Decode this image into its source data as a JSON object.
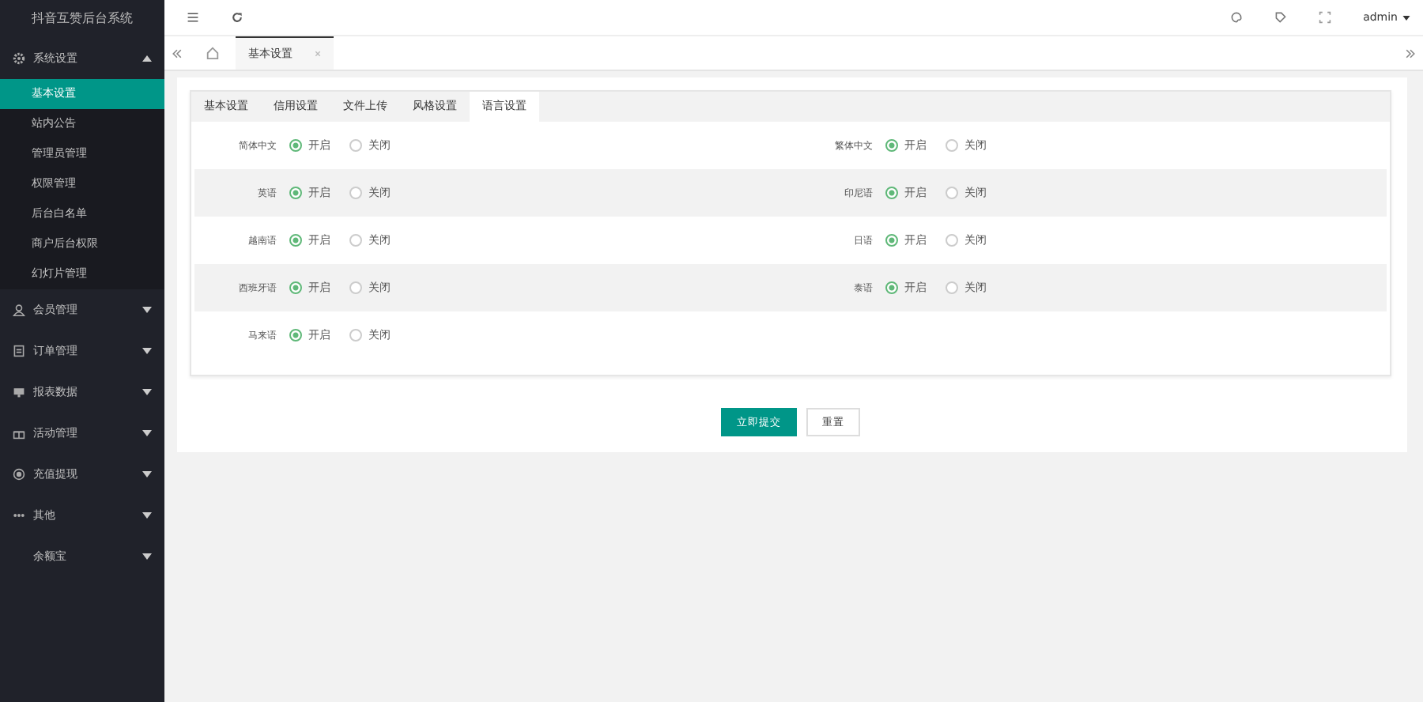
{
  "sidebar": {
    "logo": "抖音互赞后台系统",
    "menus": [
      {
        "label": "系统设置",
        "expanded": true,
        "items": [
          {
            "label": "基本设置",
            "selected": true
          },
          {
            "label": "站内公告",
            "selected": false
          },
          {
            "label": "管理员管理",
            "selected": false
          },
          {
            "label": "权限管理",
            "selected": false
          },
          {
            "label": "后台白名单",
            "selected": false
          },
          {
            "label": "商户后台权限",
            "selected": false
          },
          {
            "label": "幻灯片管理",
            "selected": false
          }
        ]
      },
      {
        "label": "会员管理",
        "expanded": false
      },
      {
        "label": "订单管理",
        "expanded": false
      },
      {
        "label": "报表数据",
        "expanded": false
      },
      {
        "label": "活动管理",
        "expanded": false
      },
      {
        "label": "充值提现",
        "expanded": false
      },
      {
        "label": "其他",
        "expanded": false
      },
      {
        "label": "余额宝",
        "expanded": false
      }
    ]
  },
  "header": {
    "user": "admin"
  },
  "page_tabs": [
    {
      "label": "基本设置",
      "selected": true
    }
  ],
  "form_tabs": [
    {
      "label": "基本设置",
      "selected": false
    },
    {
      "label": "信用设置",
      "selected": false
    },
    {
      "label": "文件上传",
      "selected": false
    },
    {
      "label": "风格设置",
      "selected": false
    },
    {
      "label": "语言设置",
      "selected": true
    }
  ],
  "languages": [
    {
      "name": "简体中文",
      "options": [
        {
          "label": "开启",
          "selected": true
        },
        {
          "label": "关闭",
          "selected": false
        }
      ]
    },
    {
      "name": "繁体中文",
      "options": [
        {
          "label": "开启",
          "selected": true
        },
        {
          "label": "关闭",
          "selected": false
        }
      ]
    },
    {
      "name": "英语",
      "options": [
        {
          "label": "开启",
          "selected": true
        },
        {
          "label": "关闭",
          "selected": false
        }
      ]
    },
    {
      "name": "印尼语",
      "options": [
        {
          "label": "开启",
          "selected": true
        },
        {
          "label": "关闭",
          "selected": false
        }
      ]
    },
    {
      "name": "越南语",
      "options": [
        {
          "label": "开启",
          "selected": true
        },
        {
          "label": "关闭",
          "selected": false
        }
      ]
    },
    {
      "name": "日语",
      "options": [
        {
          "label": "开启",
          "selected": true
        },
        {
          "label": "关闭",
          "selected": false
        }
      ]
    },
    {
      "name": "西班牙语",
      "options": [
        {
          "label": "开启",
          "selected": true
        },
        {
          "label": "关闭",
          "selected": false
        }
      ]
    },
    {
      "name": "泰语",
      "options": [
        {
          "label": "开启",
          "selected": true
        },
        {
          "label": "关闭",
          "selected": false
        }
      ]
    },
    {
      "name": "马来语",
      "options": [
        {
          "label": "开启",
          "selected": true
        },
        {
          "label": "关闭",
          "selected": false
        }
      ]
    }
  ],
  "buttons": {
    "submit": "立即提交",
    "reset": "重置"
  }
}
